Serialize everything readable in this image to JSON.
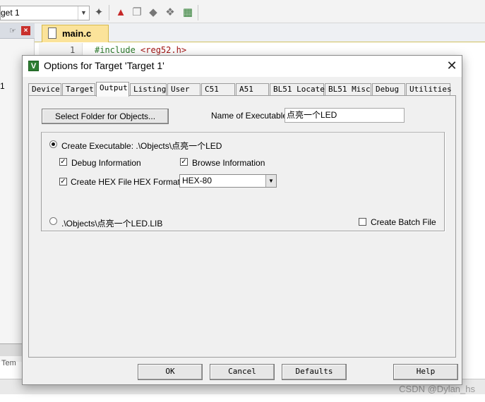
{
  "ide": {
    "target_combo": "get 1",
    "file_tab": "main.c",
    "line_number": "1",
    "code": {
      "directive": "#include",
      "header": "<reg52.h>"
    },
    "left_stub": "1",
    "bottom_tab": "Tem"
  },
  "dialog": {
    "title": "Options for Target 'Target 1'",
    "tabs": [
      "Device",
      "Target",
      "Output",
      "Listing",
      "User",
      "C51",
      "A51",
      "BL51 Locate",
      "BL51 Misc",
      "Debug",
      "Utilities"
    ],
    "active_tab": "Output",
    "output": {
      "select_folder_button": "Select Folder for Objects...",
      "name_label": "Name of Executable:",
      "name_value": "点亮一个LED",
      "create_executable_label": "Create Executable:  .\\Objects\\点亮一个LED",
      "create_executable_selected": true,
      "debug_info_label": "Debug Information",
      "debug_info_checked": true,
      "browse_info_label": "Browse Information",
      "browse_info_checked": true,
      "create_hex_label": "Create HEX File",
      "create_hex_checked": true,
      "hex_format_label": "HEX Format:",
      "hex_format_value": "HEX-80",
      "create_library_label": ".\\Objects\\点亮一个LED.LIB",
      "create_library_selected": false,
      "create_batch_label": "Create Batch File",
      "create_batch_checked": false
    },
    "buttons": {
      "ok": "OK",
      "cancel": "Cancel",
      "defaults": "Defaults",
      "help": "Help"
    }
  },
  "watermark": "CSDN @Dylan_hs"
}
